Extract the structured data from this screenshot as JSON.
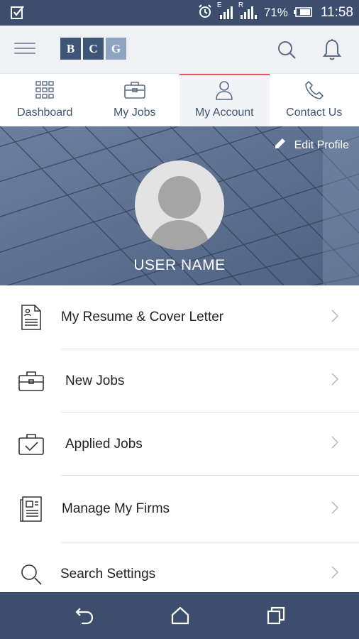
{
  "status_bar": {
    "network_labels": [
      "E",
      "R"
    ],
    "battery_percent": "71%",
    "time": "11:58"
  },
  "app_bar": {
    "logo_letters": [
      "B",
      "C",
      "G"
    ],
    "icons": [
      "menu-icon",
      "search-icon",
      "bell-icon"
    ]
  },
  "tabs": [
    {
      "label": "Dashboard",
      "icon": "grid-icon",
      "active": false
    },
    {
      "label": "My Jobs",
      "icon": "briefcase-icon",
      "active": false
    },
    {
      "label": "My Account",
      "icon": "person-icon",
      "active": true
    },
    {
      "label": "Contact Us",
      "icon": "phone-icon",
      "active": false
    }
  ],
  "profile": {
    "edit_label": "Edit Profile",
    "user_name": "USER NAME"
  },
  "menu": [
    {
      "label": "My Resume & Cover Letter",
      "icon": "resume-icon"
    },
    {
      "label": "New Jobs",
      "icon": "briefcase-icon"
    },
    {
      "label": "Applied Jobs",
      "icon": "briefcase-check-icon"
    },
    {
      "label": "Manage My Firms",
      "icon": "newspaper-icon"
    },
    {
      "label": "Search Settings",
      "icon": "search-icon"
    }
  ],
  "colors": {
    "brand_dark": "#3c4d6e",
    "tab_active_accent": "#e05561",
    "banner": "#5d7090"
  }
}
